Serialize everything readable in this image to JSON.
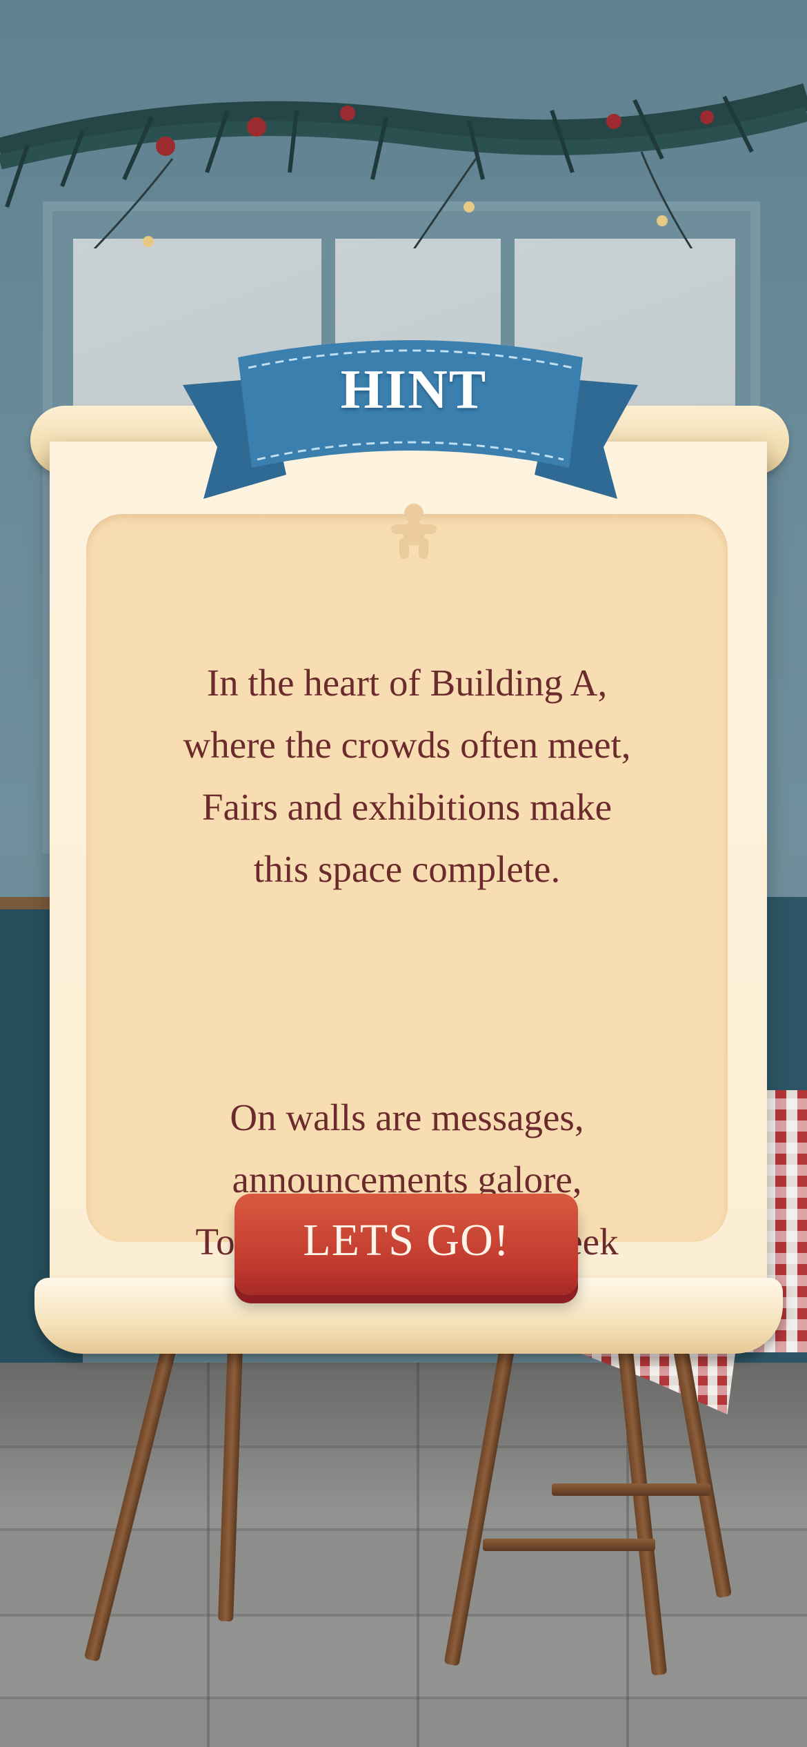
{
  "hint": {
    "title": "HINT",
    "verse1": "In the heart of Building A,\nwhere the crowds often meet,\nFairs and exhibitions make\nthis space complete.",
    "verse2": "On walls are messages,\nannouncements galore,\nTo find your next clue, seek\nthe stairs in the core!”",
    "button_label": "LETS GO!"
  },
  "colors": {
    "ribbon": "#3b7fae",
    "text": "#6b2a2c",
    "button": "#c23a2f",
    "panel": "#f9ddb2"
  },
  "icons": {
    "panel_ornament": "gingerbread-icon"
  }
}
